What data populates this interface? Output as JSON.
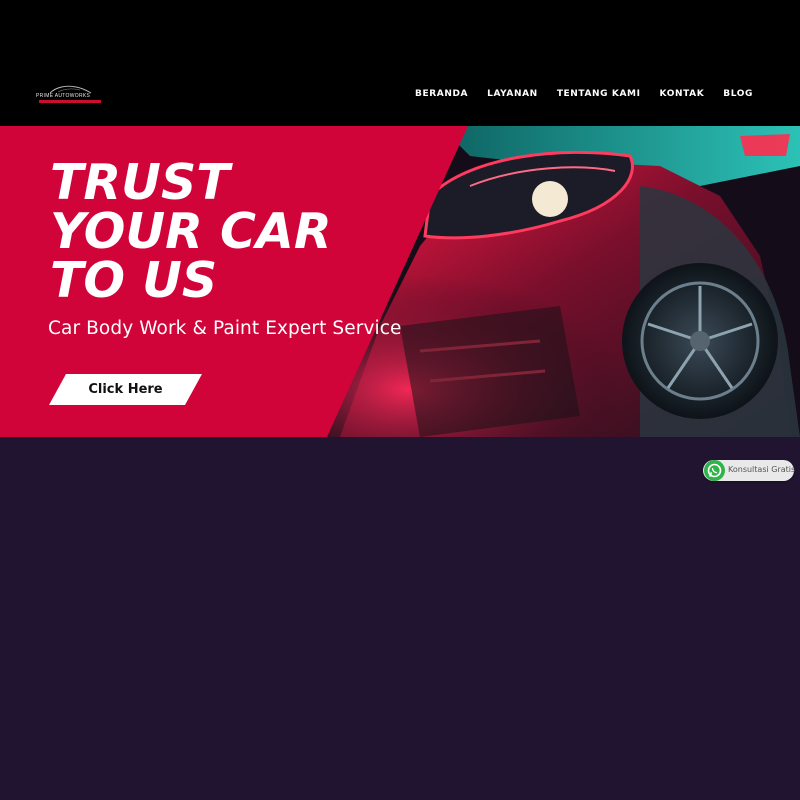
{
  "header": {
    "logo_text": "PRIME AUTOWORKS",
    "nav": [
      "BERANDA",
      "LAYANAN",
      "TENTANG KAMI",
      "KONTAK",
      "BLOG"
    ]
  },
  "hero": {
    "headline_lines": [
      "TRUST",
      "YOUR CAR",
      "TO US"
    ],
    "subtitle": "Car Body Work & Paint Expert Service",
    "cta_label": "Click Here",
    "image": "car-front-neon-photo"
  },
  "whatsapp": {
    "icon": "whatsapp-icon",
    "label": "Konsultasi Gratis"
  },
  "colors": {
    "header_bg": "#000000",
    "accent_red": "#d1043a",
    "page_bg": "#211431",
    "cta_bg": "#ffffff",
    "whatsapp_green": "#2fb34a"
  }
}
